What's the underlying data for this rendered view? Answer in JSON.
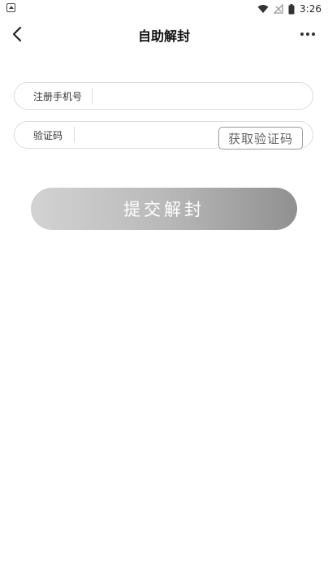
{
  "status_bar": {
    "time": "3:26",
    "icons": [
      "app-notification-icon",
      "wifi-icon",
      "no-signal-icon",
      "battery-icon"
    ]
  },
  "header": {
    "title": "自助解封",
    "back_icon": "chevron-left-icon",
    "more_icon": "more-dots-icon"
  },
  "form": {
    "phone": {
      "label": "注册手机号",
      "value": "",
      "placeholder": ""
    },
    "code": {
      "label": "验证码",
      "value": "",
      "placeholder": "",
      "get_code_label": "获取验证码"
    },
    "submit_label": "提交解封"
  },
  "colors": {
    "submit_gradient_start": "#d3d3d3",
    "submit_gradient_end": "#909090",
    "field_border": "#dcdcdc"
  }
}
